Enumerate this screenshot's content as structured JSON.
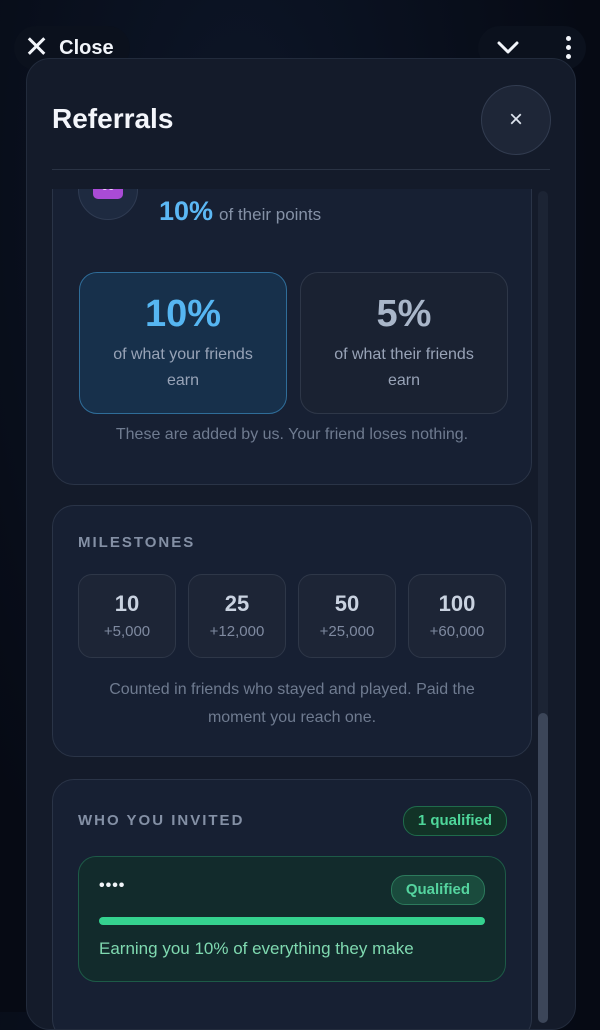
{
  "topbar": {
    "close_label": "Close",
    "close_icon": "x-icon",
    "collapse_icon": "chevron-down-icon",
    "more_icon": "kebab-icon"
  },
  "sheet": {
    "title": "Referrals",
    "close_symbol": "×"
  },
  "rewards": {
    "percent": "10%",
    "percent_suffix": "of their points",
    "avatar_glyph": "∞",
    "tier_a": {
      "value": "10%",
      "label": "of what your friends earn"
    },
    "tier_b": {
      "value": "5%",
      "label": "of what their friends earn"
    },
    "note": "These are added by us. Your friend loses nothing."
  },
  "milestones": {
    "title": "MILESTONES",
    "items": [
      {
        "count": "10",
        "reward": "+5,000"
      },
      {
        "count": "25",
        "reward": "+12,000"
      },
      {
        "count": "50",
        "reward": "+25,000"
      },
      {
        "count": "100",
        "reward": "+60,000"
      }
    ],
    "note": "Counted in friends who stayed and played. Paid the moment you reach one."
  },
  "invited": {
    "title": "WHO YOU INVITED",
    "badge": "1 qualified",
    "friend": {
      "name": "••••",
      "status": "Qualified",
      "progress": 1.0,
      "earning": "Earning you 10% of everything they make"
    }
  },
  "colors": {
    "accent_blue": "#56b6f2",
    "accent_green": "#35d28f",
    "background": "#141b2a"
  }
}
